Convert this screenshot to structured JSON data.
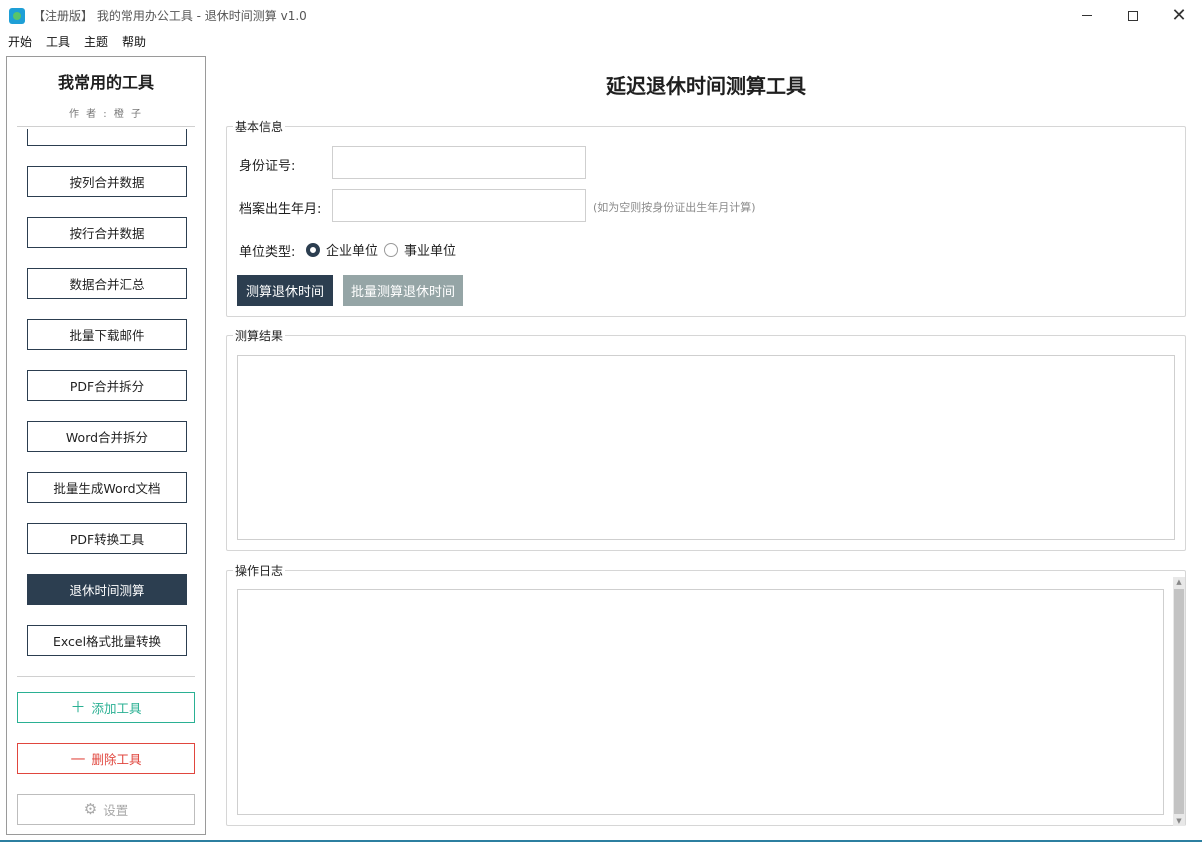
{
  "window": {
    "title": "【注册版】 我的常用办公工具 - 退休时间测算 v1.0"
  },
  "menu": [
    "开始",
    "工具",
    "主题",
    "帮助"
  ],
  "sidebar": {
    "title": "我常用的工具",
    "author": "作 者 : 橙 子",
    "tools": [
      {
        "label": ""
      },
      {
        "label": "按列合并数据"
      },
      {
        "label": "按行合并数据"
      },
      {
        "label": "数据合并汇总"
      },
      {
        "label": "批量下载邮件"
      },
      {
        "label": "PDF合并拆分"
      },
      {
        "label": "Word合并拆分"
      },
      {
        "label": "批量生成Word文档"
      },
      {
        "label": "PDF转换工具"
      },
      {
        "label": "退休时间测算",
        "active": true
      },
      {
        "label": "Excel格式批量转换"
      }
    ],
    "add_label": "添加工具",
    "delete_label": "删除工具",
    "settings_label": "设置"
  },
  "main": {
    "title": "延迟退休时间测算工具",
    "basic_group": {
      "legend": "基本信息",
      "id_label": "身份证号:",
      "id_value": "",
      "birth_label": "档案出生年月:",
      "birth_value": "",
      "birth_hint": "(如为空则按身份证出生年月计算)",
      "unit_label": "单位类型:",
      "unit_options": [
        "企业单位",
        "事业单位"
      ],
      "unit_selected": "企业单位",
      "calc_button": "测算退休时间",
      "batch_button": "批量测算退休时间"
    },
    "result_group": {
      "legend": "测算结果",
      "content": ""
    },
    "log_group": {
      "legend": "操作日志",
      "content": ""
    }
  },
  "colors": {
    "primary": "#2c3e50",
    "secondary_button": "#95a5a6",
    "add": "#2ab093",
    "delete": "#e0463e"
  }
}
